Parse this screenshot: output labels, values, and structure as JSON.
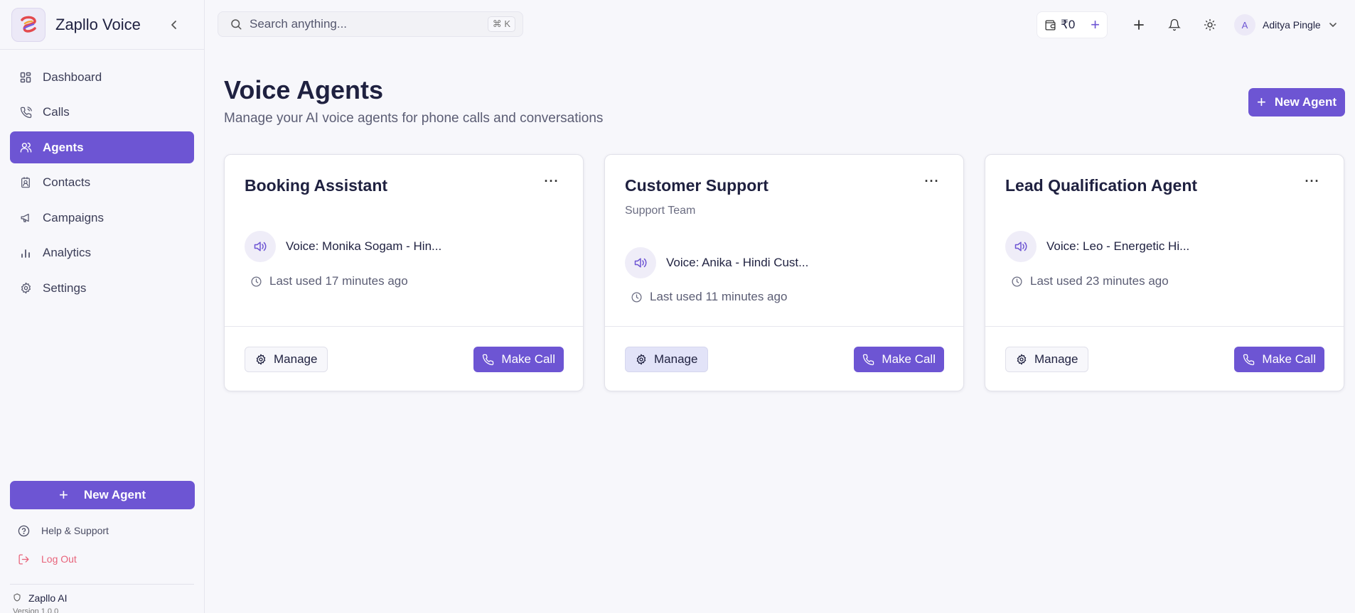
{
  "brand": {
    "name": "Zapllo Voice",
    "footer_name": "Zapllo AI",
    "version": "Version 1.0.0"
  },
  "sidebar": {
    "items": [
      {
        "label": "Dashboard",
        "icon": "grid-icon",
        "active": false
      },
      {
        "label": "Calls",
        "icon": "phone-icon",
        "active": false
      },
      {
        "label": "Agents",
        "icon": "users-icon",
        "active": true
      },
      {
        "label": "Contacts",
        "icon": "contact-card-icon",
        "active": false
      },
      {
        "label": "Campaigns",
        "icon": "megaphone-icon",
        "active": false
      },
      {
        "label": "Analytics",
        "icon": "bar-chart-icon",
        "active": false
      },
      {
        "label": "Settings",
        "icon": "gear-icon",
        "active": false
      }
    ],
    "new_agent_label": "New Agent",
    "help_label": "Help & Support",
    "logout_label": "Log Out"
  },
  "topbar": {
    "search_placeholder": "Search anything...",
    "shortcut": "⌘ K",
    "wallet_balance": "₹0",
    "user_initial": "A",
    "user_name": "Aditya Pingle"
  },
  "page": {
    "title": "Voice Agents",
    "subtitle": "Manage your AI voice agents for phone calls and conversations",
    "new_agent_label": "New Agent"
  },
  "agents": [
    {
      "name": "Booking Assistant",
      "team": "",
      "voice": "Voice: Monika Sogam - Hin...",
      "last_used": "Last used 17 minutes ago",
      "manage_label": "Manage",
      "call_label": "Make Call"
    },
    {
      "name": "Customer Support",
      "team": "Support Team",
      "voice": "Voice: Anika - Hindi Cust...",
      "last_used": "Last used 11 minutes ago",
      "manage_label": "Manage",
      "call_label": "Make Call"
    },
    {
      "name": "Lead Qualification Agent",
      "team": "",
      "voice": "Voice: Leo - Energetic Hi...",
      "last_used": "Last used 23 minutes ago",
      "manage_label": "Manage",
      "call_label": "Make Call"
    }
  ],
  "colors": {
    "accent": "#6d55d3",
    "logout": "#e8637a",
    "background": "#f7f7fb"
  }
}
